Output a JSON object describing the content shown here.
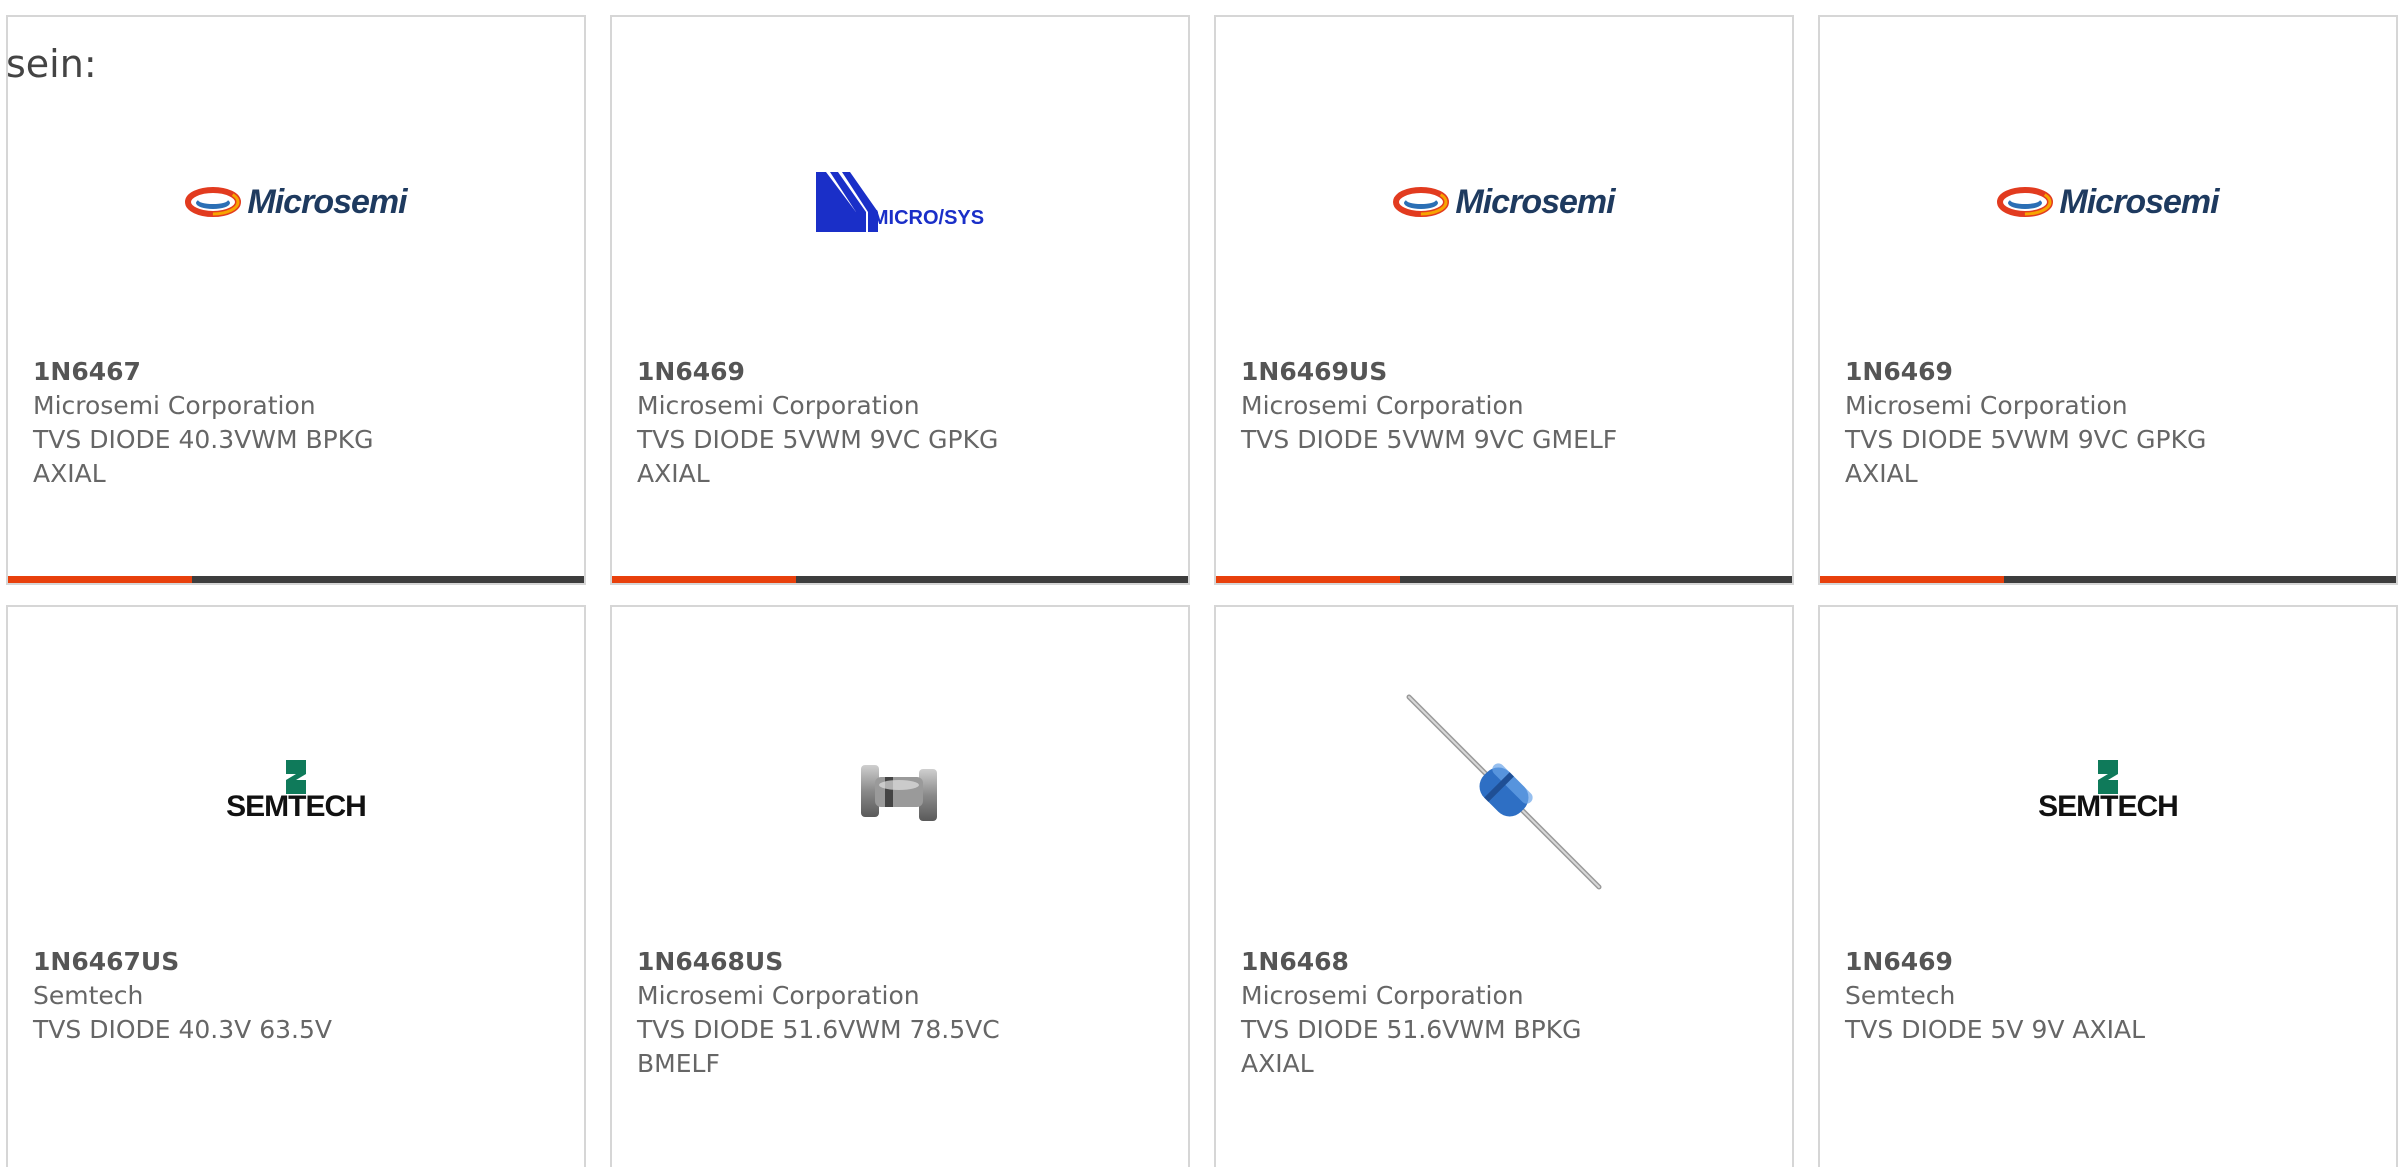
{
  "lead_text": "sein:",
  "cards": [
    {
      "part": "1N6467",
      "manufacturer": "Microsemi Corporation",
      "description": "TVS DIODE 40.3VWM BPKG AXIAL",
      "logo": "microsemi-logo",
      "logo_text": "Microsemi"
    },
    {
      "part": "1N6469",
      "manufacturer": "Microsemi Corporation",
      "description": "TVS DIODE 5VWM 9VC GPKG AXIAL",
      "logo": "microsys-logo",
      "logo_text": "MICRO/SYS"
    },
    {
      "part": "1N6469US",
      "manufacturer": "Microsemi Corporation",
      "description": "TVS DIODE 5VWM 9VC GMELF",
      "logo": "microsemi-logo",
      "logo_text": "Microsemi"
    },
    {
      "part": "1N6469",
      "manufacturer": "Microsemi Corporation",
      "description": "TVS DIODE 5VWM 9VC GPKG AXIAL",
      "logo": "microsemi-logo",
      "logo_text": "Microsemi"
    },
    {
      "part": "1N6467US",
      "manufacturer": "Semtech",
      "description": "TVS DIODE 40.3V 63.5V",
      "logo": "semtech-logo",
      "logo_text": "SEMTECH"
    },
    {
      "part": "1N6468US",
      "manufacturer": "Microsemi Corporation",
      "description": "TVS DIODE 51.6VWM 78.5VC BMELF",
      "logo": "melf-diode-photo"
    },
    {
      "part": "1N6468",
      "manufacturer": "Microsemi Corporation",
      "description": "TVS DIODE 51.6VWM BPKG AXIAL",
      "logo": "axial-diode-photo"
    },
    {
      "part": "1N6469",
      "manufacturer": "Semtech",
      "description": "TVS DIODE 5V 9V AXIAL",
      "logo": "semtech-logo",
      "logo_text": "SEMTECH"
    }
  ],
  "colors": {
    "accent": "#e8400c",
    "bar": "#3d3d3d",
    "border": "#d6d6d6",
    "text": "#666666"
  }
}
